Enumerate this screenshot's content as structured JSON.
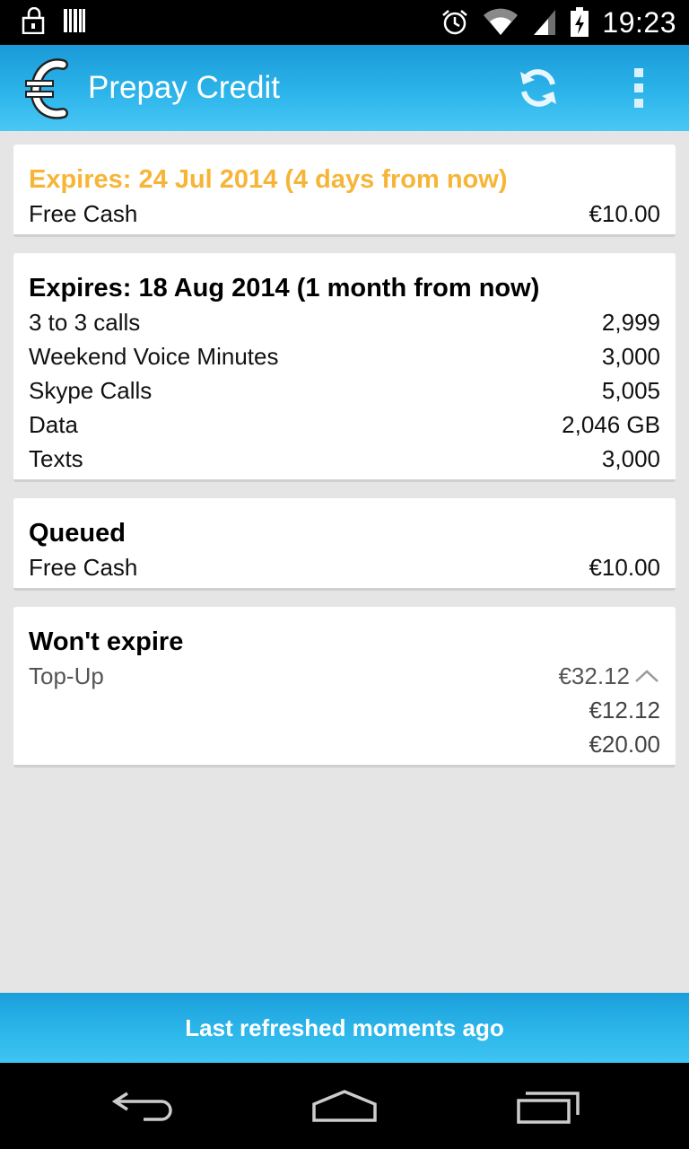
{
  "status_bar": {
    "time": "19:23",
    "icons": [
      "lock-icon",
      "barcode-icon",
      "alarm-icon",
      "wifi-icon",
      "signal-icon",
      "battery-charging-icon"
    ]
  },
  "action_bar": {
    "title": "Prepay Credit",
    "logo_icon": "euro-phone-logo",
    "refresh_icon": "refresh-icon",
    "overflow_icon": "overflow-menu-icon"
  },
  "cards": [
    {
      "title": "Expires: 24 Jul 2014 (4 days from now)",
      "rows": [
        {
          "label": "Free Cash",
          "value": "€10.00"
        }
      ]
    },
    {
      "title": "Expires: 18 Aug 2014 (1 month from now)",
      "rows": [
        {
          "label": "3 to 3 calls",
          "value": "2,999"
        },
        {
          "label": "Weekend Voice Minutes",
          "value": "3,000"
        },
        {
          "label": "Skype Calls",
          "value": "5,005"
        },
        {
          "label": "Data",
          "value": "2,046 GB"
        },
        {
          "label": "Texts",
          "value": "3,000"
        }
      ]
    },
    {
      "title": "Queued",
      "rows": [
        {
          "label": "Free Cash",
          "value": "€10.00"
        }
      ]
    },
    {
      "title": "Won't expire",
      "rows": [
        {
          "label": "Top-Up",
          "value": "€32.12"
        },
        {
          "label": "",
          "value": "€12.12"
        },
        {
          "label": "",
          "value": "€20.00"
        }
      ]
    }
  ],
  "banner": {
    "text": "Last refreshed moments ago"
  },
  "nav_bar": {
    "icons": [
      "back-icon",
      "home-icon",
      "recent-apps-icon"
    ]
  },
  "colors": {
    "accent": "#2cb4ea",
    "expiring_soon": "#f7b538"
  }
}
